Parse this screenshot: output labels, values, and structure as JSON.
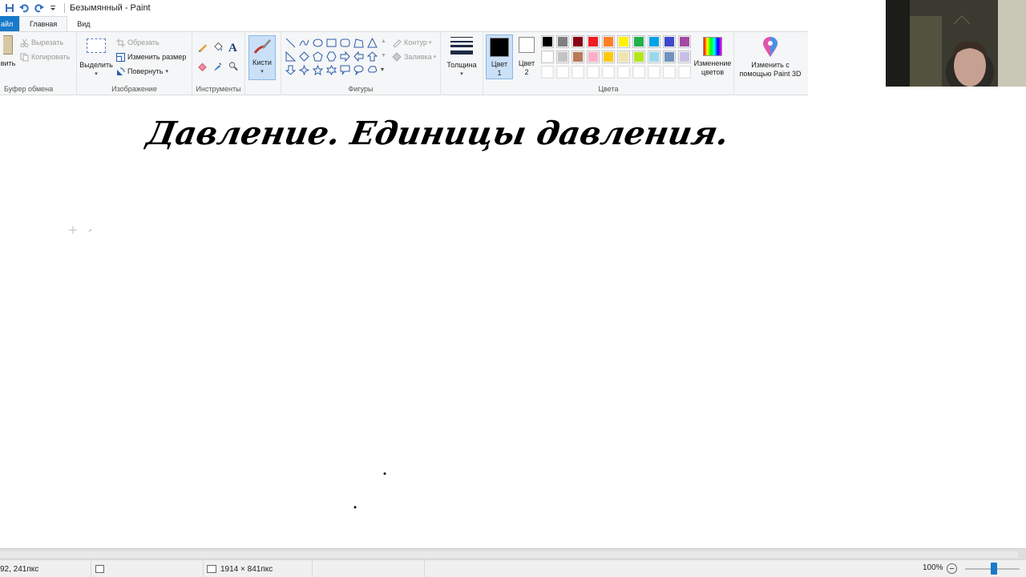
{
  "window": {
    "title": "Безымянный - Paint"
  },
  "tabs": [
    {
      "label": "айл"
    },
    {
      "label": "Главная"
    },
    {
      "label": "Вид"
    }
  ],
  "clipboard": {
    "paste_label": "вить",
    "cut_label": "Вырезать",
    "copy_label": "Копировать",
    "group_label": "Буфер обмена"
  },
  "image": {
    "select_label": "Выделить",
    "crop_label": "Обрезать",
    "resize_label": "Изменить размер",
    "rotate_label": "Повернуть",
    "group_label": "Изображение"
  },
  "tools": {
    "group_label": "Инструменты",
    "brushes_label": "Кисти",
    "text_glyph": "A"
  },
  "shapes": {
    "group_label": "Фигуры",
    "outline_label": "Контур",
    "fill_label": "Заливка"
  },
  "size": {
    "label": "Толщина"
  },
  "colors": {
    "group_label": "Цвета",
    "color1_label": "Цвет",
    "color1_num": "1",
    "color2_label": "Цвет",
    "color2_num": "2",
    "color1_value": "#000000",
    "color2_value": "#ffffff",
    "edit_label_1": "Изменение",
    "edit_label_2": "цветов",
    "paint3d_label_1": "Изменить с",
    "paint3d_label_2": "помощью Paint 3D",
    "palette": [
      "#000000",
      "#7f7f7f",
      "#880015",
      "#ed1c24",
      "#ff7f27",
      "#fff200",
      "#22b14c",
      "#00a2e8",
      "#3f48cc",
      "#a349a4",
      "#ffffff",
      "#c3c3c3",
      "#b97a57",
      "#ffaec9",
      "#ffc90e",
      "#efe4b0",
      "#b5e61d",
      "#99d9ea",
      "#7092be",
      "#c8bfe7",
      "#ffffff",
      "#ffffff",
      "#ffffff",
      "#ffffff",
      "#ffffff",
      "#ffffff",
      "#ffffff",
      "#ffffff",
      "#ffffff",
      "#ffffff"
    ]
  },
  "canvas": {
    "handwriting": "Давление. Единицы давления."
  },
  "status": {
    "cursor_pos": "92, 241пкс",
    "image_size": "1914 × 841пкс",
    "zoom": "100%"
  }
}
